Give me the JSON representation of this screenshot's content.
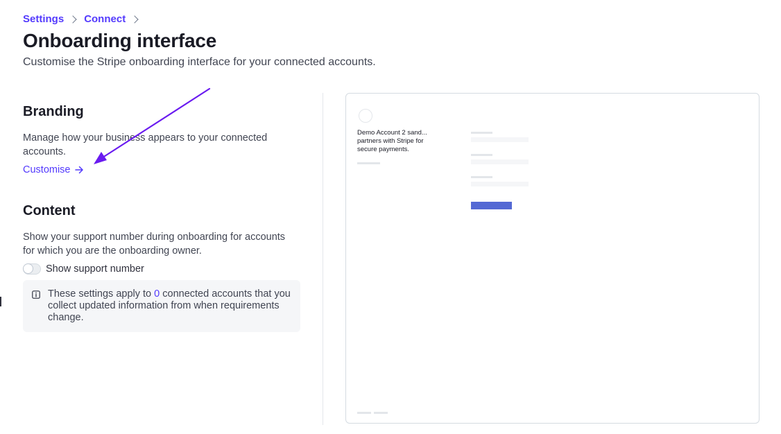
{
  "breadcrumb": {
    "items": [
      "Settings",
      "Connect"
    ]
  },
  "header": {
    "title": "Onboarding interface",
    "subtitle": "Customise the Stripe onboarding interface for your connected accounts."
  },
  "branding": {
    "title": "Branding",
    "description": "Manage how your business appears to your connected accounts.",
    "link_label": "Customise",
    "link_icon": "arrow-right-icon"
  },
  "content": {
    "title": "Content",
    "description": "Show your support number during onboarding for accounts for which you are the onboarding owner.",
    "toggle_label": "Show support number",
    "toggle_on": false,
    "info": {
      "icon": "info-icon",
      "text_before": "These settings apply to ",
      "count": "0",
      "text_after": " connected accounts that you collect updated information from when requirements change."
    }
  },
  "preview": {
    "account_description": "Demo Account 2 sand... partners with Stripe for secure payments."
  },
  "colors": {
    "accent": "#533afd",
    "preview_button": "#5469d4",
    "annotation_arrow": "#6a1bf0"
  }
}
